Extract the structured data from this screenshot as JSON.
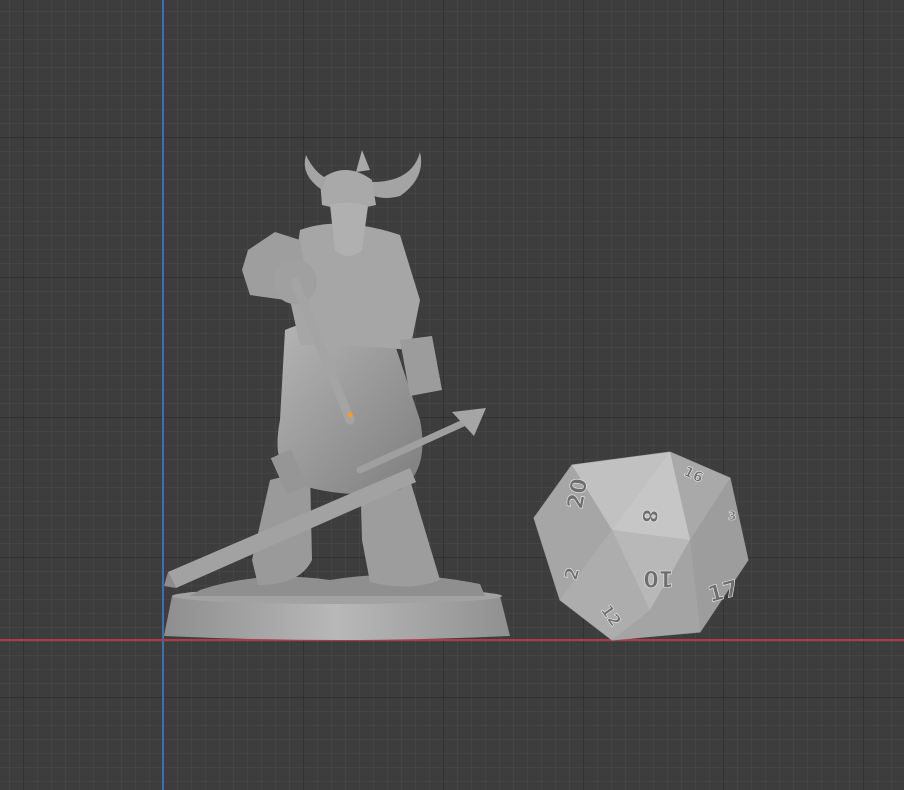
{
  "viewport": {
    "background": "#3d3d3d",
    "grid_color": "#2e2e2e",
    "axis_x_color": "#b0394a",
    "axis_y_color": "#3c6fb0",
    "origin_marker_color": "#ff9a1f"
  },
  "scene": {
    "objects": [
      {
        "name": "skeleton-viking-miniature",
        "color": "#a9a9a9"
      },
      {
        "name": "d20-die",
        "color": "#b3b3b3"
      }
    ],
    "die_face_numbers": [
      "20",
      "8",
      "16",
      "3",
      "2",
      "10",
      "17",
      "12"
    ]
  }
}
